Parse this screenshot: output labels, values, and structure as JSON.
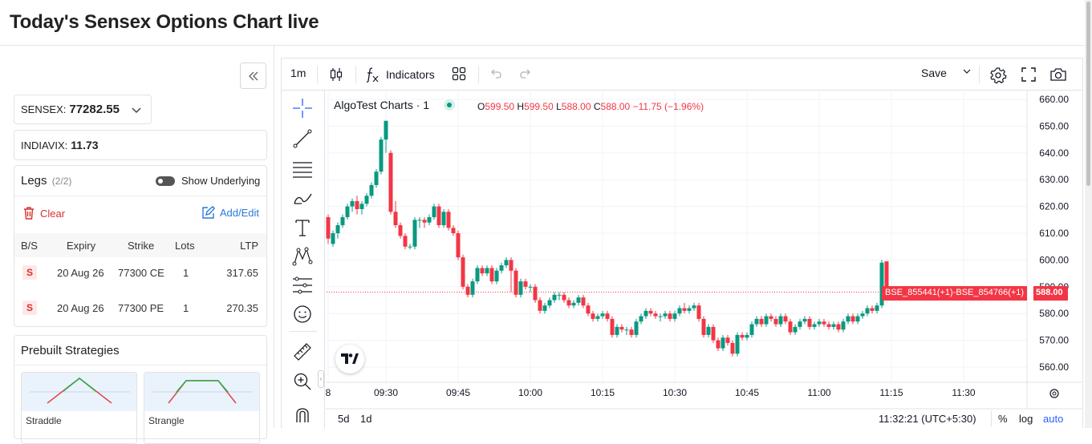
{
  "page": {
    "title": "Today's Sensex Options Chart live"
  },
  "colors": {
    "up": "#089981",
    "down": "#f23645",
    "accent": "#2962ff",
    "clear": "#d9302f",
    "link": "#2a7bd6"
  },
  "sidebar": {
    "collapse_icon": "double-chevron-left-icon",
    "index": {
      "label": "SENSEX:",
      "value": "77282.55"
    },
    "vix": {
      "label": "INDIAVIX:",
      "value": "11.73"
    },
    "legs": {
      "title": "Legs",
      "count": "(2/2)",
      "toggle_label": "Show Underlying",
      "clear_label": "Clear",
      "add_label": "Add/Edit",
      "columns": [
        "B/S",
        "Expiry",
        "Strike",
        "Lots",
        "LTP"
      ],
      "rows": [
        {
          "side": "S",
          "expiry": "20 Aug 26",
          "strike": "77300 CE",
          "lots": "1",
          "ltp": "317.65"
        },
        {
          "side": "S",
          "expiry": "20 Aug 26",
          "strike": "77300 PE",
          "lots": "1",
          "ltp": "270.35"
        }
      ]
    },
    "prebuilt": {
      "title": "Prebuilt Strategies",
      "items": [
        {
          "label": "Straddle"
        },
        {
          "label": "Strangle"
        }
      ]
    }
  },
  "chart": {
    "toolbar": {
      "interval": "1m",
      "indicators_label": "Indicators",
      "save_label": "Save"
    },
    "legend": {
      "title": "AlgoTest Charts · 1",
      "o_key": "O",
      "o": "599.50",
      "h_key": "H",
      "h": "599.50",
      "l_key": "L",
      "l": "588.00",
      "c_key": "C",
      "c": "588.00",
      "change": "−11.75 (−1.96%)"
    },
    "series_label": "BSE_855441(+1)-BSE_854766(+1)",
    "last_price": "588.00",
    "bottom": {
      "range_5d": "5d",
      "range_1d": "1d",
      "time": "11:32:21 (UTC+5:30)",
      "pct": "%",
      "log": "log",
      "auto": "auto"
    }
  },
  "chart_data": {
    "type": "candlestick",
    "title": "AlgoTest Charts · 1",
    "y_ticks": [
      "660.00",
      "650.00",
      "640.00",
      "630.00",
      "620.00",
      "610.00",
      "600.00",
      "590.00",
      "580.00",
      "570.00",
      "560.00"
    ],
    "ylim": [
      555,
      663
    ],
    "x_ticks": [
      {
        "label": "8",
        "bar": 0
      },
      {
        "label": "09:30",
        "bar": 12
      },
      {
        "label": "09:45",
        "bar": 27
      },
      {
        "label": "10:00",
        "bar": 42
      },
      {
        "label": "10:15",
        "bar": 57
      },
      {
        "label": "10:30",
        "bar": 72
      },
      {
        "label": "10:45",
        "bar": 87
      },
      {
        "label": "11:00",
        "bar": 102
      },
      {
        "label": "11:15",
        "bar": 117
      },
      {
        "label": "11:30",
        "bar": 132
      }
    ],
    "grid": true,
    "candles": [
      [
        616,
        608,
        617,
        606
      ],
      [
        606,
        610,
        611,
        605
      ],
      [
        610,
        613,
        614,
        608
      ],
      [
        613,
        616,
        617,
        612
      ],
      [
        616,
        620,
        621,
        615
      ],
      [
        620,
        622,
        623,
        618
      ],
      [
        622,
        619,
        624,
        617
      ],
      [
        619,
        621,
        622,
        617
      ],
      [
        621,
        624,
        625,
        620
      ],
      [
        624,
        628,
        629,
        623
      ],
      [
        628,
        633,
        634,
        627
      ],
      [
        633,
        645,
        646,
        632
      ],
      [
        645,
        652,
        652,
        640
      ],
      [
        640,
        618,
        641,
        617
      ],
      [
        618,
        613,
        622,
        612
      ],
      [
        613,
        609,
        614,
        608
      ],
      [
        609,
        605,
        610,
        604
      ],
      [
        605,
        605,
        606,
        604
      ],
      [
        605,
        615,
        616,
        604
      ],
      [
        615,
        615,
        616,
        612
      ],
      [
        615,
        614,
        616,
        612
      ],
      [
        614,
        616,
        617,
        613
      ],
      [
        616,
        620,
        621,
        615
      ],
      [
        620,
        613,
        621,
        612
      ],
      [
        613,
        618,
        619,
        612
      ],
      [
        618,
        612,
        619,
        611
      ],
      [
        612,
        610,
        613,
        609
      ],
      [
        610,
        601,
        611,
        600
      ],
      [
        601,
        590,
        602,
        589
      ],
      [
        590,
        587,
        591,
        586
      ],
      [
        587,
        592,
        593,
        586
      ],
      [
        592,
        597,
        598,
        591
      ],
      [
        597,
        595,
        598,
        594
      ],
      [
        595,
        597,
        598,
        594
      ],
      [
        597,
        592,
        598,
        591
      ],
      [
        592,
        596,
        597,
        591
      ],
      [
        596,
        598,
        599,
        595
      ],
      [
        598,
        600,
        601,
        597
      ],
      [
        600,
        596,
        601,
        588
      ],
      [
        596,
        587,
        597,
        586
      ],
      [
        587,
        592,
        593,
        586
      ],
      [
        592,
        590,
        593,
        589
      ],
      [
        590,
        590,
        591,
        588
      ],
      [
        590,
        585,
        591,
        584
      ],
      [
        585,
        581,
        586,
        580
      ],
      [
        581,
        583,
        584,
        580
      ],
      [
        583,
        585,
        586,
        582
      ],
      [
        585,
        587,
        588,
        584
      ],
      [
        587,
        587,
        588,
        585
      ],
      [
        587,
        585,
        588,
        584
      ],
      [
        585,
        583,
        586,
        582
      ],
      [
        583,
        584,
        585,
        582
      ],
      [
        584,
        586,
        587,
        583
      ],
      [
        586,
        583,
        587,
        582
      ],
      [
        583,
        580,
        584,
        579
      ],
      [
        580,
        578,
        581,
        577
      ],
      [
        578,
        579,
        580,
        577
      ],
      [
        579,
        580,
        581,
        578
      ],
      [
        580,
        578,
        581,
        577
      ],
      [
        578,
        572,
        579,
        571
      ],
      [
        572,
        575,
        576,
        571
      ],
      [
        575,
        574,
        576,
        573
      ],
      [
        574,
        574,
        575,
        572
      ],
      [
        574,
        572,
        575,
        571
      ],
      [
        572,
        577,
        578,
        571
      ],
      [
        577,
        579,
        580,
        576
      ],
      [
        579,
        581,
        582,
        578
      ],
      [
        581,
        580,
        582,
        579
      ],
      [
        580,
        579,
        581,
        578
      ],
      [
        579,
        579,
        580,
        577
      ],
      [
        579,
        580,
        581,
        578
      ],
      [
        580,
        578,
        581,
        577
      ],
      [
        578,
        580,
        581,
        577
      ],
      [
        580,
        582,
        583,
        579
      ],
      [
        582,
        581,
        584,
        580
      ],
      [
        581,
        582,
        583,
        580
      ],
      [
        582,
        583,
        584,
        581
      ],
      [
        583,
        578,
        584,
        577
      ],
      [
        578,
        572,
        579,
        571
      ],
      [
        572,
        575,
        576,
        571
      ],
      [
        575,
        570,
        576,
        569
      ],
      [
        570,
        567,
        571,
        566
      ],
      [
        567,
        571,
        572,
        566
      ],
      [
        571,
        569,
        572,
        568
      ],
      [
        569,
        565,
        570,
        564
      ],
      [
        565,
        572,
        573,
        564
      ],
      [
        572,
        571,
        573,
        570
      ],
      [
        571,
        572,
        573,
        570
      ],
      [
        572,
        576,
        577,
        571
      ],
      [
        576,
        578,
        579,
        575
      ],
      [
        578,
        576,
        579,
        575
      ],
      [
        576,
        579,
        580,
        575
      ],
      [
        579,
        578,
        580,
        577
      ],
      [
        578,
        576,
        579,
        575
      ],
      [
        576,
        579,
        580,
        575
      ],
      [
        579,
        577,
        580,
        576
      ],
      [
        577,
        573,
        578,
        572
      ],
      [
        573,
        575,
        576,
        572
      ],
      [
        575,
        577,
        578,
        574
      ],
      [
        577,
        578,
        579,
        576
      ],
      [
        578,
        575,
        579,
        574
      ],
      [
        575,
        576,
        577,
        574
      ],
      [
        576,
        577,
        578,
        575
      ],
      [
        577,
        576,
        578,
        575
      ],
      [
        576,
        575,
        577,
        574
      ],
      [
        575,
        576,
        577,
        574
      ],
      [
        576,
        574,
        577,
        573
      ],
      [
        574,
        577,
        578,
        573
      ],
      [
        577,
        579,
        580,
        576
      ],
      [
        579,
        577,
        580,
        576
      ],
      [
        577,
        579,
        580,
        576
      ],
      [
        579,
        580,
        581,
        578
      ],
      [
        580,
        582,
        583,
        579
      ],
      [
        582,
        581,
        583,
        580
      ],
      [
        581,
        583,
        584,
        580
      ],
      [
        583,
        599,
        600,
        582
      ],
      [
        599.5,
        588,
        599.5,
        588
      ]
    ]
  }
}
